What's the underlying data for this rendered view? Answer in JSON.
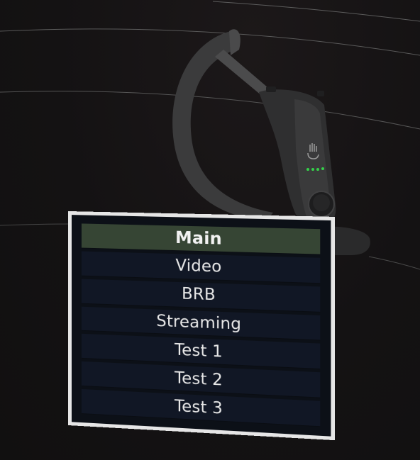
{
  "colors": {
    "background": "#131112",
    "panel_border": "#e6e6e6",
    "panel_fill": "#0c1017",
    "item_fill": "#111725",
    "active_item_fill": "#364534",
    "text": "#e8e8e8",
    "controller_led": "#35d14a"
  },
  "scene": {
    "controller_icon": "vr-controller-icon"
  },
  "menu": {
    "items": [
      {
        "label": "Main",
        "selected": true
      },
      {
        "label": "Video",
        "selected": false
      },
      {
        "label": "BRB",
        "selected": false
      },
      {
        "label": "Streaming",
        "selected": false
      },
      {
        "label": "Test 1",
        "selected": false
      },
      {
        "label": "Test 2",
        "selected": false
      },
      {
        "label": "Test 3",
        "selected": false
      }
    ]
  }
}
